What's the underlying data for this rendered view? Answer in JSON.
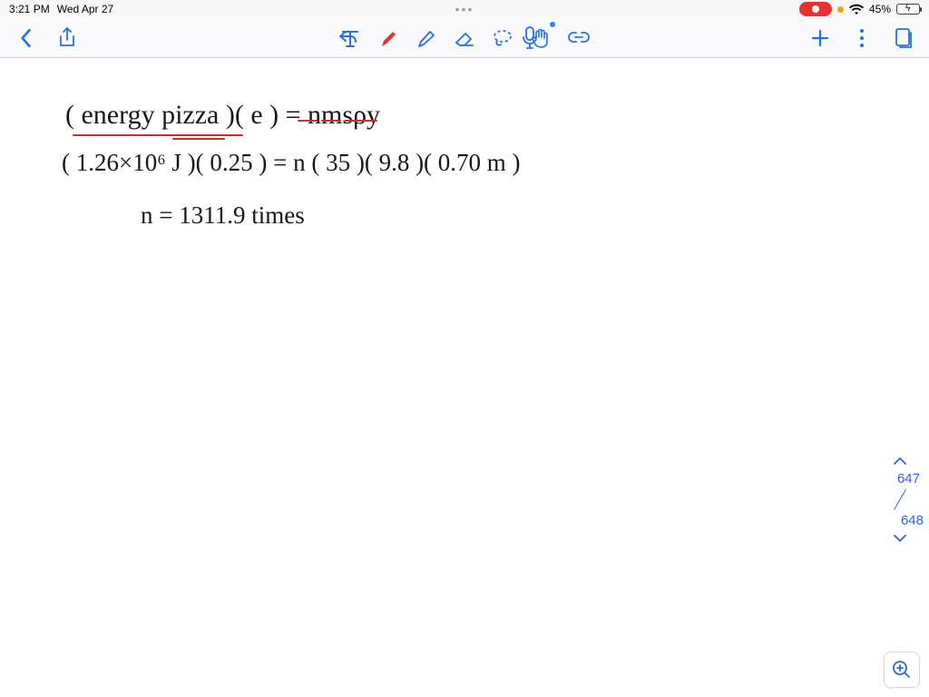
{
  "status": {
    "time": "3:21 PM",
    "date": "Wed Apr 27",
    "center_dots": "•••",
    "battery_percent": "45%",
    "battery_fill_pct": 45
  },
  "toolbar": {
    "icons": {
      "back": "back-chevron-icon",
      "share": "share-icon",
      "undo": "undo-icon",
      "text": "text-tool-icon",
      "pen": "pen-tool-icon",
      "highlighter": "highlighter-tool-icon",
      "eraser": "eraser-tool-icon",
      "lasso": "lasso-tool-icon",
      "hand": "hand-tool-icon",
      "link": "link-tool-icon",
      "mic": "microphone-icon",
      "add": "add-icon",
      "more": "more-icon",
      "pages": "pages-icon"
    }
  },
  "handwriting": {
    "line1": "( energy  pizza )( e ) = nmsρy",
    "line2": "( 1.26×10⁶ J )( 0.25 ) = n ( 35 )( 9.8 )( 0.70 m )",
    "line3": "n = 1311.9  times"
  },
  "pageNav": {
    "current": "647",
    "total": "648"
  }
}
